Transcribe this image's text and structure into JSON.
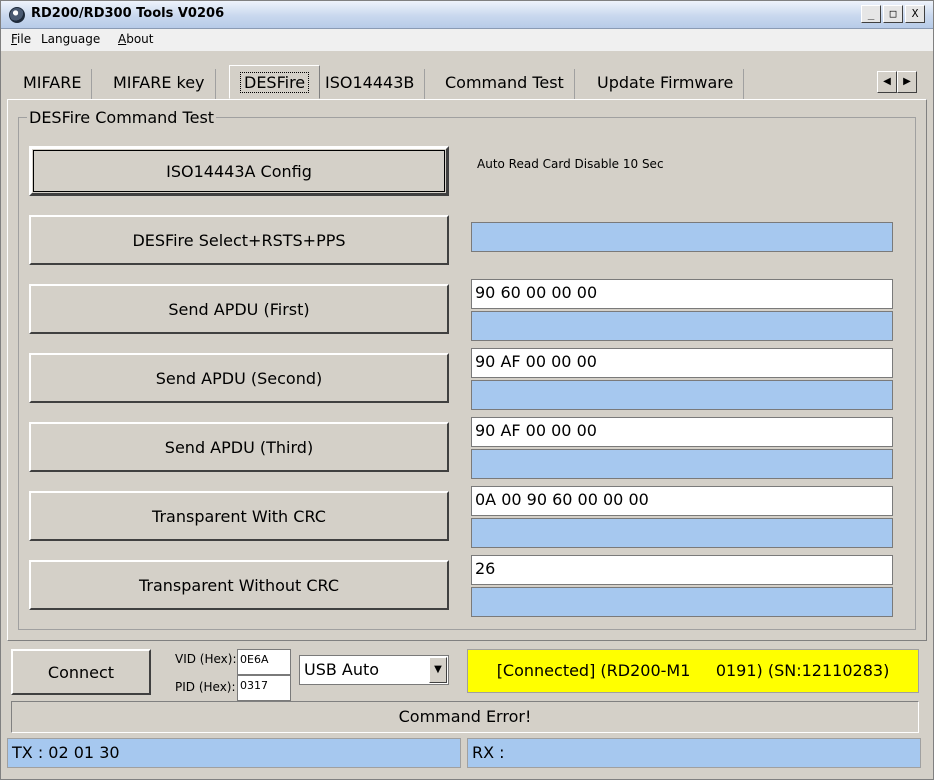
{
  "window": {
    "title": "RD200/RD300 Tools V0206",
    "controls": {
      "minimize": "_",
      "maximize": "□",
      "close": "X"
    }
  },
  "menu": {
    "file": {
      "mnemonic": "F",
      "rest": "ile"
    },
    "language": "Language",
    "about": {
      "mnemonic": "A",
      "rest": "bout"
    }
  },
  "tabs": [
    "MIFARE",
    "MIFARE key",
    "DESFire",
    "ISO14443B",
    "Command Test",
    "Update Firmware"
  ],
  "active_tab": "DESFire",
  "tab_scroll": {
    "left": "◀",
    "right": "▶"
  },
  "group": {
    "title": "DESFire Command Test",
    "auto_read_note": "Auto Read Card Disable 10 Sec",
    "buttons": {
      "iso_config": "ISO14443A Config",
      "desfire_select": "DESFire Select+RSTS+PPS",
      "apdu_first": "Send APDU (First)",
      "apdu_second": "Send APDU (Second)",
      "apdu_third": "Send APDU (Third)",
      "transparent_crc": "Transparent With CRC",
      "transparent_no_crc": "Transparent Without CRC"
    },
    "inputs": {
      "apdu_first": "90 60 00 00 00",
      "apdu_second": "90 AF 00 00 00",
      "apdu_third": "90 AF 00 00 00",
      "transparent_crc": "0A 00 90 60 00 00 00",
      "transparent_no_crc": "26"
    }
  },
  "connection": {
    "connect_label": "Connect",
    "vid_label": "VID (Hex):",
    "vid_value": "0E6A",
    "pid_label": "PID (Hex):",
    "pid_value": "0317",
    "mode_selected": "USB Auto",
    "mode_arrow": "▼",
    "status": "[Connected] (RD200-M1     0191) (SN:12110283)"
  },
  "status_message": "Command Error!",
  "tx": "TX : 02 01 30",
  "rx": "RX :"
}
